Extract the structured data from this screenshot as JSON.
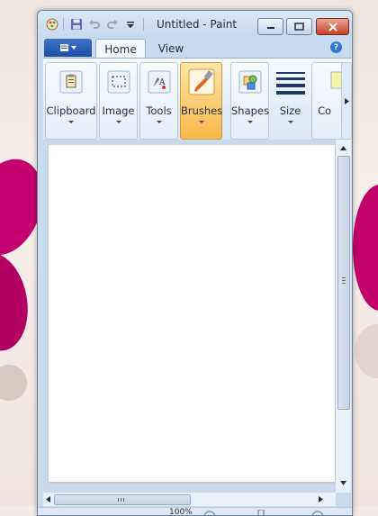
{
  "window": {
    "title": "Untitled - Paint"
  },
  "qat": {
    "items": [
      "paint-app-icon",
      "save-icon",
      "undo-icon",
      "redo-icon",
      "customize-qat-icon"
    ]
  },
  "tabs": {
    "home": "Home",
    "view": "View"
  },
  "ribbon": {
    "groups": [
      {
        "label": "Clipboard",
        "icon": "clipboard-icon"
      },
      {
        "label": "Image",
        "icon": "select-icon"
      },
      {
        "label": "Tools",
        "icon": "tools-icon"
      },
      {
        "label": "Brushes",
        "icon": "brush-icon",
        "active": true
      },
      {
        "label": "Shapes",
        "icon": "shapes-icon"
      },
      {
        "label": "Size",
        "icon": "size-icon"
      },
      {
        "label": "Co",
        "icon": "colors-icon"
      }
    ]
  },
  "status": {
    "zoom": "100%"
  },
  "colors": {
    "accent": "#2f79d4",
    "active_group": "#fbd17a",
    "brush_color": "#e06a25"
  }
}
